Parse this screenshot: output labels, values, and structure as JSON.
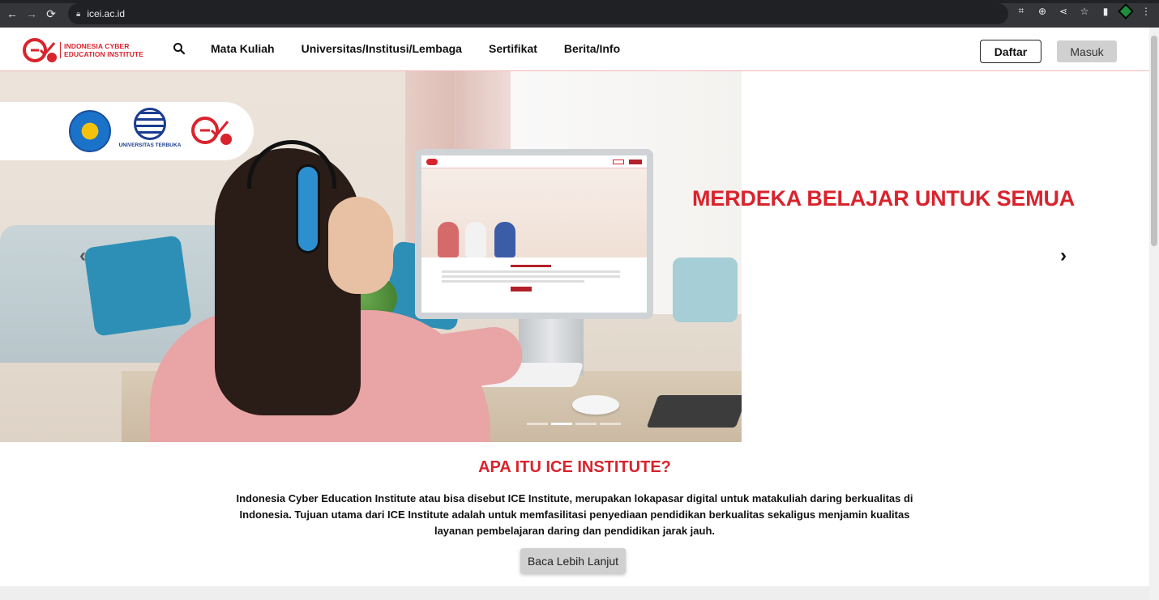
{
  "browser": {
    "url": "icei.ac.id",
    "back_icon": "arrow-left-icon",
    "forward_icon": "arrow-right-icon",
    "reload_icon": "reload-icon"
  },
  "header": {
    "logo_line1": "INDONESIA CYBER",
    "logo_line2": "EDUCATION INSTITUTE",
    "nav": [
      "Mata Kuliah",
      "Universitas/Institusi/Lembaga",
      "Sertifikat",
      "Berita/Info"
    ],
    "daftar_label": "Daftar",
    "masuk_label": "Masuk"
  },
  "hero": {
    "headline": "MERDEKA BELAJAR UNTUK SEMUA",
    "partner_ut_label": "UNIVERSITAS TERBUKA",
    "slide_count": 4,
    "active_slide": 2
  },
  "about": {
    "title": "APA ITU ICE INSTITUTE?",
    "text": "Indonesia Cyber Education Institute atau bisa disebut ICE Institute, merupakan lokapasar digital untuk matakuliah daring berkualitas di Indonesia. Tujuan utama dari ICE Institute adalah untuk memfasilitasi penyediaan pendidikan berkualitas sekaligus menjamin kualitas layanan pembelajaran daring dan pendidikan jarak jauh.",
    "button_label": "Baca Lebih Lanjut"
  },
  "colors": {
    "brand_red": "#d9232d",
    "button_gray": "#d0d0d0"
  }
}
